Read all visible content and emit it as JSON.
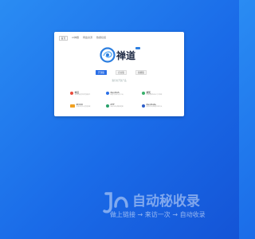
{
  "nav": {
    "items": [
      "首页",
      "AI神器",
      "网盘资源",
      "数据挖掘"
    ]
  },
  "logo": {
    "name": "禅道",
    "badge_color": "#2d7fe0"
  },
  "actions": {
    "buttons": [
      "开源版",
      "企业版",
      "旗舰版"
    ],
    "active_index": 0
  },
  "subtitle": "我们的开源产品",
  "products": [
    {
      "name": "禅道",
      "desc": "专业的研发项目管理软件",
      "color": "#e94b3c",
      "icon": "zentao-icon"
    },
    {
      "name": "ZenDAS",
      "desc": "数据可视化分析工具",
      "color": "#2b6fe6",
      "icon": "zendas-icon"
    },
    {
      "name": "蝉知",
      "desc": "开源免费的企业门户系统",
      "color": "#38b06a",
      "icon": "chanzhi-icon"
    },
    {
      "name": "ZDOO",
      "desc": "开源协同办公管理系统",
      "color": "#f0a020",
      "icon": "zdoo-icon"
    },
    {
      "name": "ZTF",
      "desc": "自动化测试集成框架",
      "color": "#27a06a",
      "icon": "ztf-icon"
    },
    {
      "name": "ZenData",
      "desc": "通用的测试数据生成工具",
      "color": "#2b5cc8",
      "icon": "zendata-icon"
    }
  ],
  "watermark": {
    "title": "自动秘收录",
    "subtitle": "做上链接 → 来访一次 → 自动收录"
  },
  "colors": {
    "background": "#1a6be8",
    "accent": "#2b6fe6"
  }
}
